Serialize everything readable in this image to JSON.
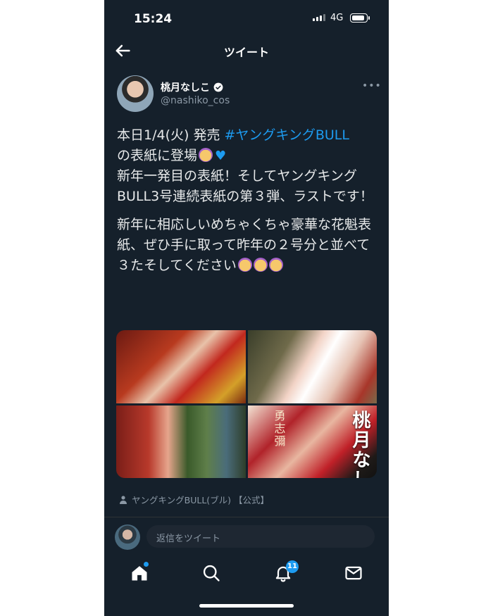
{
  "status_bar": {
    "time": "15:24",
    "network": "4G"
  },
  "header": {
    "title": "ツイート",
    "back_icon": "arrow-left-icon"
  },
  "author": {
    "name": "桃月なしこ",
    "handle": "@nashiko_cos",
    "verified": true
  },
  "tweet": {
    "line1_prefix": "本日1/4(火) 発売 ",
    "hashtag": "#ヤングキングBULL",
    "line1_suffix": "の表紙に登場",
    "paragraph1_rest": "新年一発目の表紙！そしてヤングキングBULL3号連続表紙の第３弾、ラストです！",
    "paragraph2": "新年に相応しいめちゃくちゃ豪華な花魁表紙、ぜひ手に取って昨年の２号分と並べて３たそしてください"
  },
  "media": {
    "photos": [
      "photo-1",
      "photo-2",
      "photo-3",
      "photo-4"
    ],
    "cover_title": "桃月なし",
    "cover_side_text": "勇志彌"
  },
  "source_label": "ヤングキングBULL(ブル) 【公式】",
  "reply": {
    "placeholder": "返信をツイート"
  },
  "tabbar": {
    "notifications_badge": "11"
  },
  "colors": {
    "background": "#15202b",
    "accent": "#1d9bf0",
    "muted": "#8b98a5"
  }
}
